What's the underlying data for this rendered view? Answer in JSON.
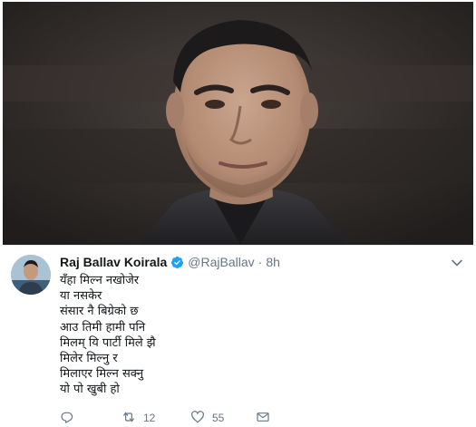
{
  "tweet": {
    "author_name": "Raj Ballav Koirala",
    "handle": "@RajBallav",
    "separator": "·",
    "time": "8h",
    "lines": [
      "यँहा मिल्न नखोजेर",
      "या नसकेर",
      "संसार नै बिग्रेको छ",
      "आउ तिमी हामी पनि",
      "मिलम् यि पार्टी मिले झै",
      "मिलेर मिल्नु र",
      "मिलाएर मिल्न सक्नु",
      "यो पो खुबी हो"
    ],
    "actions": {
      "replies": "",
      "retweets": "12",
      "likes": "55"
    }
  },
  "icons": {
    "verified": "verified-badge-icon",
    "caret": "chevron-down-icon",
    "reply": "reply-icon",
    "retweet": "retweet-icon",
    "like": "heart-icon",
    "dm": "envelope-icon"
  },
  "colors": {
    "verified_blue": "#1da1f2",
    "meta_gray": "#657786",
    "text": "#14171a"
  }
}
